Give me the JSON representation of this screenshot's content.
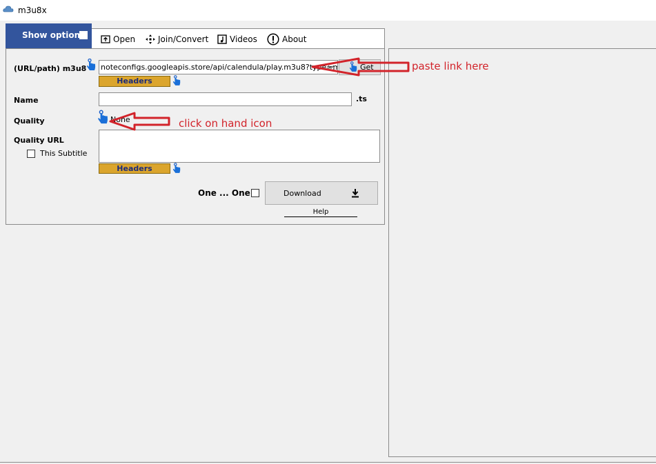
{
  "window": {
    "title": "m3u8x"
  },
  "toolbar": {
    "show_options": "Show options",
    "items": [
      {
        "label": "Open",
        "icon": "open-icon"
      },
      {
        "label": "Join/Convert",
        "icon": "join-convert-icon"
      },
      {
        "label": "Videos",
        "icon": "videos-icon"
      },
      {
        "label": "About",
        "icon": "about-icon"
      }
    ]
  },
  "form": {
    "url_label": "(URL/path) m3u8",
    "url_value": "noteconfigs.googleapis.store/api/calendula/play.m3u8?type=movie",
    "get_label": "Get",
    "headers_label": "Headers",
    "name_label": "Name",
    "name_value": "",
    "name_suffix": ".ts",
    "quality_label": "Quality",
    "quality_value": "None",
    "quality_url_label": "Quality URL",
    "quality_url_value": "",
    "subtitle_label": "This Subtitle",
    "one_label": "One ... One",
    "download_label": "Download",
    "help_label": "Help"
  },
  "annotations": {
    "paste": "paste link here",
    "click": "click on hand icon"
  },
  "colors": {
    "accent": "#33559d",
    "headers_button": "#dba52d",
    "annotation": "#d2232a"
  }
}
